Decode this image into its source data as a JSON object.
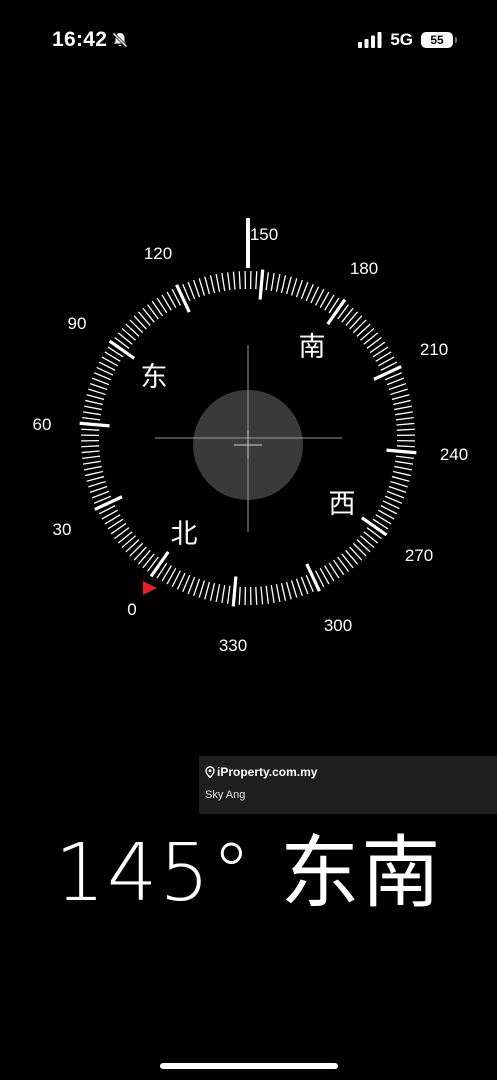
{
  "status_bar": {
    "time": "16:42",
    "network": "5G",
    "battery": "55",
    "icons": [
      "bell-slash-icon",
      "cellular-signal-icon",
      "battery-icon"
    ]
  },
  "compass": {
    "heading_degrees": 145,
    "degree_labels": [
      "0",
      "30",
      "60",
      "90",
      "120",
      "150",
      "180",
      "210",
      "240",
      "270",
      "300",
      "330"
    ],
    "cardinal_labels": {
      "north": "北",
      "east": "东",
      "south": "南",
      "west": "西"
    },
    "colors": {
      "tick": "#ffffff",
      "north_marker": "#e0202a",
      "center_disc": "#3a3a3a",
      "crosshair": "#9a9a9a"
    }
  },
  "watermark": {
    "brand": "iProperty.com.my",
    "author": "Sky Ang",
    "icon": "location-pin-icon"
  },
  "readout": {
    "degrees": "145°",
    "direction": "东南"
  }
}
